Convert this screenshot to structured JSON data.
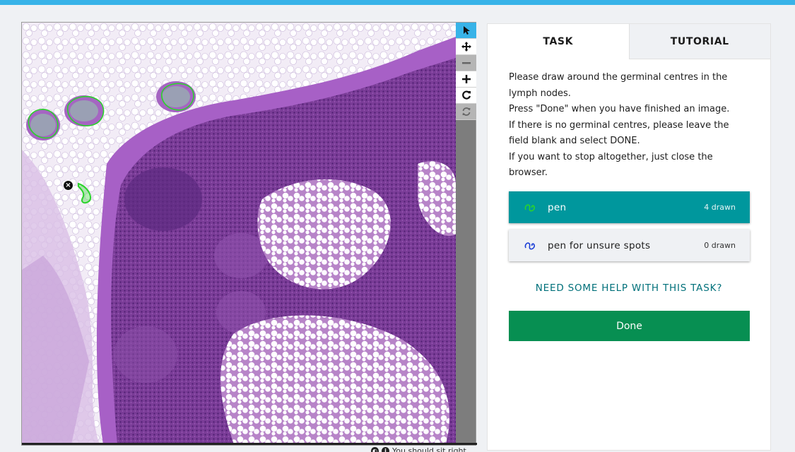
{
  "viewer": {
    "tools": [
      {
        "name": "pointer",
        "icon": "pointer-icon",
        "active": true
      },
      {
        "name": "pan",
        "icon": "move-icon",
        "active": false
      },
      {
        "name": "zoom-out",
        "icon": "minus-icon",
        "disabled": true
      },
      {
        "name": "zoom-in",
        "icon": "plus-icon",
        "active": false
      },
      {
        "name": "rotate",
        "icon": "rotate-icon",
        "active": false
      },
      {
        "name": "reset",
        "icon": "refresh-icon",
        "disabled": true
      }
    ],
    "footer_text": "You should sit right"
  },
  "panel": {
    "tabs": [
      {
        "label": "TASK",
        "active": true
      },
      {
        "label": "TUTORIAL",
        "active": false
      }
    ],
    "instructions": [
      "Please draw around the germinal centres in the lymph nodes.",
      "Press \"Done\" when you have finished an image.",
      "If there is no germinal centres, please leave the field blank and select DONE.",
      "If you want to stop altogether, just close the browser."
    ],
    "tools": [
      {
        "label": "pen",
        "count": "4 drawn",
        "icon_color": "#00e64d"
      },
      {
        "label": "pen for unsure spots",
        "count": "0 drawn",
        "icon_color": "#1a3dd6"
      }
    ],
    "help_label": "NEED SOME HELP WITH THIS TASK?",
    "done_label": "Done"
  },
  "colors": {
    "accent": "#38b3e8",
    "teal": "#00979d",
    "done_green": "#078f52",
    "drawing": "#2bd42b"
  }
}
